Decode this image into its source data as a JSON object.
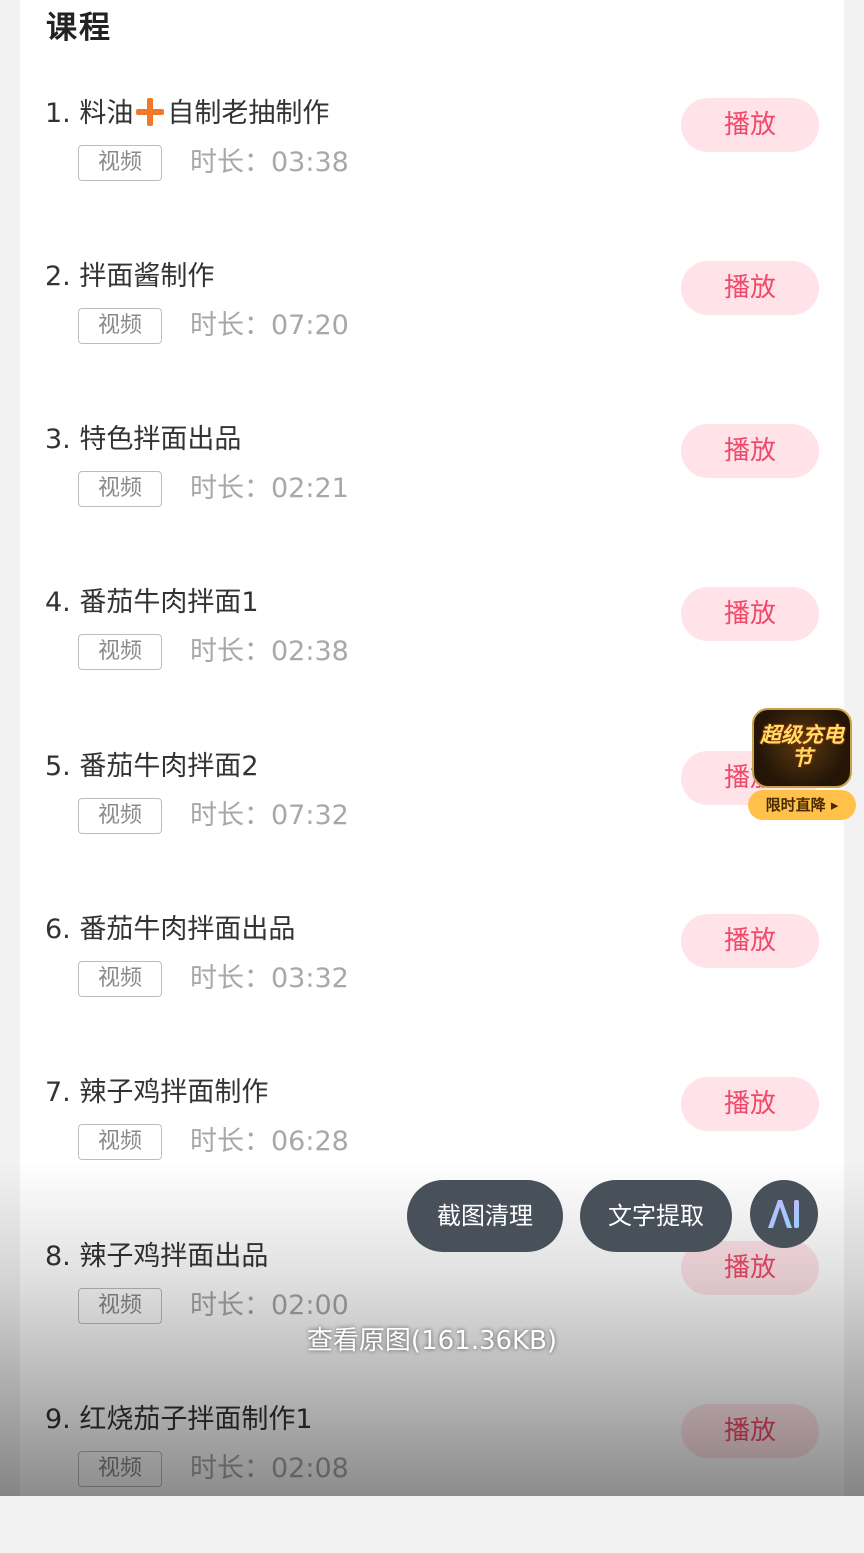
{
  "section": {
    "title": "课程"
  },
  "lessons": [
    {
      "num": "1.",
      "title_a": "料油",
      "title_b": "自制老抽制作",
      "tag": "视频",
      "duration": "时长：03:38",
      "play_label": "播放"
    },
    {
      "num": "2.",
      "title": "拌面酱制作",
      "tag": "视频",
      "duration": "时长：07:20",
      "play_label": "播放"
    },
    {
      "num": "3.",
      "title": "特色拌面出品",
      "tag": "视频",
      "duration": "时长：02:21",
      "play_label": "播放"
    },
    {
      "num": "4.",
      "title": "番茄牛肉拌面1",
      "tag": "视频",
      "duration": "时长：02:38",
      "play_label": "播放"
    },
    {
      "num": "5.",
      "title": "番茄牛肉拌面2",
      "tag": "视频",
      "duration": "时长：07:32",
      "play_label": "播放"
    },
    {
      "num": "6.",
      "title": "番茄牛肉拌面出品",
      "tag": "视频",
      "duration": "时长：03:32",
      "play_label": "播放"
    },
    {
      "num": "7.",
      "title": "辣子鸡拌面制作",
      "tag": "视频",
      "duration": "时长：06:28",
      "play_label": "播放"
    },
    {
      "num": "8.",
      "title": "辣子鸡拌面出品",
      "tag": "视频",
      "duration": "时长：02:00",
      "play_label": "播放"
    },
    {
      "num": "9.",
      "title": "红烧茄子拌面制作1",
      "tag": "视频",
      "duration": "时长：02:08",
      "play_label": "播放"
    }
  ],
  "overlay": {
    "clean_label": "截图清理",
    "text_extract_label": "文字提取",
    "ai_icon": "ai-icon",
    "view_original": "查看原图(161.36KB)"
  },
  "promo": {
    "badge_text": "超级充电节",
    "cta": "限时直降 ▸"
  },
  "colors": {
    "play_bg": "#ffe3e8",
    "play_text": "#f0496a",
    "plus_icon": "#f07a2a",
    "pill_bg": "#48505a"
  }
}
